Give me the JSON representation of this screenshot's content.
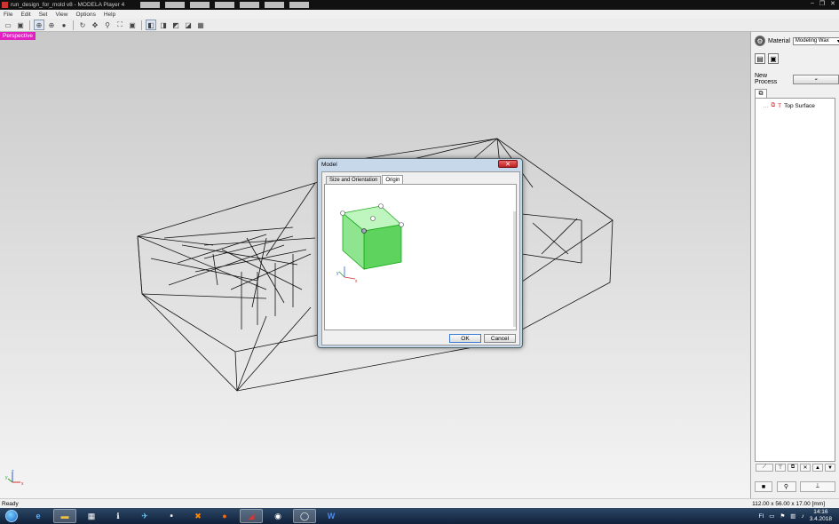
{
  "window": {
    "title": "run_design_for_mold v8 - MODELA Player 4",
    "minimize": "‒",
    "maximize": "❐",
    "close": "✕"
  },
  "menu": [
    "File",
    "Edit",
    "Set",
    "View",
    "Options",
    "Help"
  ],
  "toolbar": {
    "icons": [
      "open-file-icon",
      "save-icon",
      "cursor-select-icon",
      "move-view-icon",
      "zoom-in-icon",
      "zoom-out-icon",
      "rotate-icon",
      "pan-icon",
      "zoom-icon",
      "zoom-window-icon",
      "fit-all-icon",
      "view-iso-icon",
      "view-front-icon",
      "view-side-icon",
      "view-top-icon",
      "view-grid-icon"
    ]
  },
  "viewport": {
    "label": "Perspective",
    "axis_x": "x",
    "axis_y": "y",
    "axis_z": "z"
  },
  "right_panel": {
    "material_label": "Material",
    "material_value": "Modeling Wax",
    "new_process_label": "New Process",
    "tree_items": [
      "Top Surface"
    ]
  },
  "dialog": {
    "title": "Model",
    "tabs": [
      "Size and Orientation",
      "Origin"
    ],
    "active_tab": "Origin",
    "ok_label": "OK",
    "cancel_label": "Cancel",
    "axis_x": "x",
    "axis_y": "y",
    "cube_color": "#7ee27e"
  },
  "status": {
    "left": "Ready",
    "right": "112.00 x 56.00 x 17.00 [mm]"
  },
  "taskbar": {
    "apps": [
      "internet-explorer-icon",
      "file-explorer-icon",
      "calculator-icon",
      "info-icon",
      "pin-icon",
      "sonos-icon",
      "xampp-icon",
      "firefox-icon",
      "modela-icon",
      "media-icon",
      "app-ring-icon",
      "word-icon"
    ],
    "language": "FI",
    "time": "14:16",
    "date": "3.4.2018"
  },
  "colors": {
    "accent_perspective": "#e020c0",
    "taskbar": "#1b3150"
  }
}
